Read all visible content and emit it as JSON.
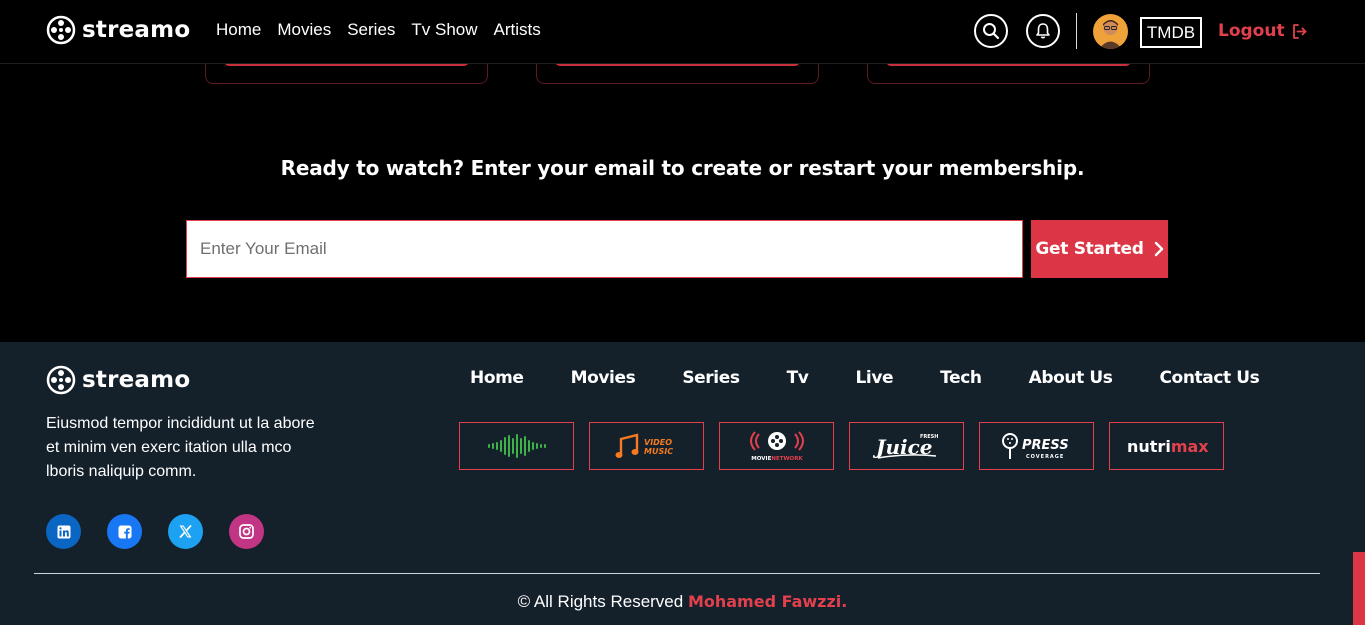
{
  "brand": {
    "name": "streamo",
    "accent": "#dc3545"
  },
  "nav": {
    "links": [
      "Home",
      "Movies",
      "Series",
      "Tv Show",
      "Artists"
    ],
    "tmdb_label": "TMDB",
    "logout_label": "Logout"
  },
  "cta": {
    "heading": "Ready to watch? Enter your email to create or restart your membership.",
    "email_placeholder": "Enter Your Email",
    "button_label": "Get Started"
  },
  "footer": {
    "description": "Eiusmod tempor incididunt ut la abore et minim ven exerc itation ulla mco lboris naliquip comm.",
    "nav_links": [
      "Home",
      "Movies",
      "Series",
      "Tv",
      "Live",
      "Tech",
      "About Us",
      "Contact Us"
    ],
    "partners": [
      {
        "name": "sound-wave-logo",
        "text": ""
      },
      {
        "name": "video-music-logo",
        "text": "VIDEO MUSIC"
      },
      {
        "name": "movie-network-logo",
        "text": "MOVIE NETWORK"
      },
      {
        "name": "juice-logo",
        "text": "Juice"
      },
      {
        "name": "press-coverage-logo",
        "text": "PRESS COVERAGE"
      },
      {
        "name": "nutrimax-logo",
        "text": "nutrimax"
      }
    ],
    "socials": [
      {
        "name": "linkedin-icon",
        "color": "#0a66c2"
      },
      {
        "name": "facebook-icon",
        "color": "#1877f2"
      },
      {
        "name": "twitter-x-icon",
        "color": "#1da1f2"
      },
      {
        "name": "instagram-icon",
        "color": "#c13584"
      }
    ],
    "copyright_prefix": "© All Rights Reserved",
    "copyright_author": "Mohamed Fawzzi."
  }
}
